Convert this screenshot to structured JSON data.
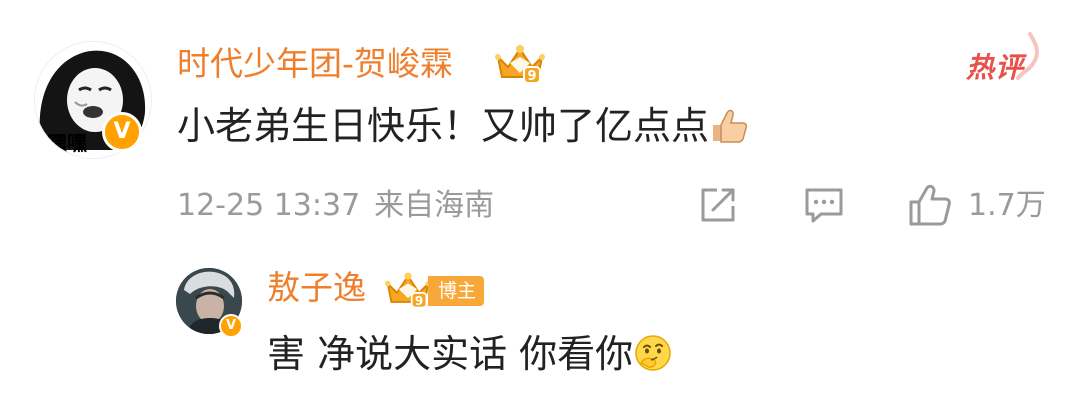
{
  "comment": {
    "username": "时代少年团-贺峻霖",
    "level": "9",
    "hot_label": "热评",
    "text": "小老弟生日快乐！又帅了亿点点",
    "text_emoji": "thumbs-up-emoji",
    "avatar_caption": "嘿嘿",
    "verified_label": "V",
    "timestamp": "12-25 13:37",
    "location": "来自海南",
    "like_count": "1.7万",
    "icons": [
      "share-icon",
      "comment-icon",
      "like-icon"
    ]
  },
  "reply": {
    "username": "敖子逸",
    "level": "9",
    "role_tag": "博主",
    "text": "害 净说大实话 你看你",
    "text_emoji": "thinking-face-emoji",
    "verified_label": "V"
  },
  "colors": {
    "username": "#ef7f2c",
    "text": "#222222",
    "meta": "#9a9a9a",
    "verified": "#ffa200",
    "hot": "#e8524a",
    "role_tag_bg": "#f8a838"
  }
}
